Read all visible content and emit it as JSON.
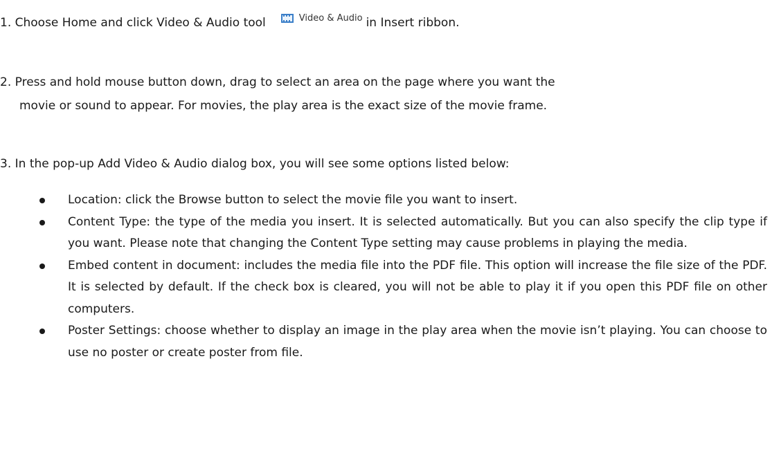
{
  "steps": [
    {
      "before": "1. Choose Home and click Video & Audio tool",
      "tool_label": "Video & Audio",
      "tool_icon": "film-strip-icon",
      "after": "in Insert ribbon."
    },
    {
      "line_a": "2. Press and hold mouse button down, drag to select an area on the page where you want the",
      "line_b": "movie or sound to appear. For movies, the play area is the exact size of the movie frame."
    },
    {
      "text": "3. In the pop-up Add Video & Audio dialog box, you will see some options listed below:"
    }
  ],
  "bullets": [
    "Location: click the Browse button to select the movie file you want to insert.",
    "Content Type: the type of the media you insert. It is selected automatically. But you can also specify the clip type if you want. Please note that changing the Content Type setting may cause problems in playing the media.",
    "Embed content in document: includes the media file into the PDF file. This option will increase the file size of the PDF. It is selected by default. If the check box is cleared, you will not be able to play it if you open this PDF file on other computers.",
    "Poster Settings: choose whether to display an image in the play area when the movie isn’t playing. You can choose to use no poster or create poster from file."
  ]
}
